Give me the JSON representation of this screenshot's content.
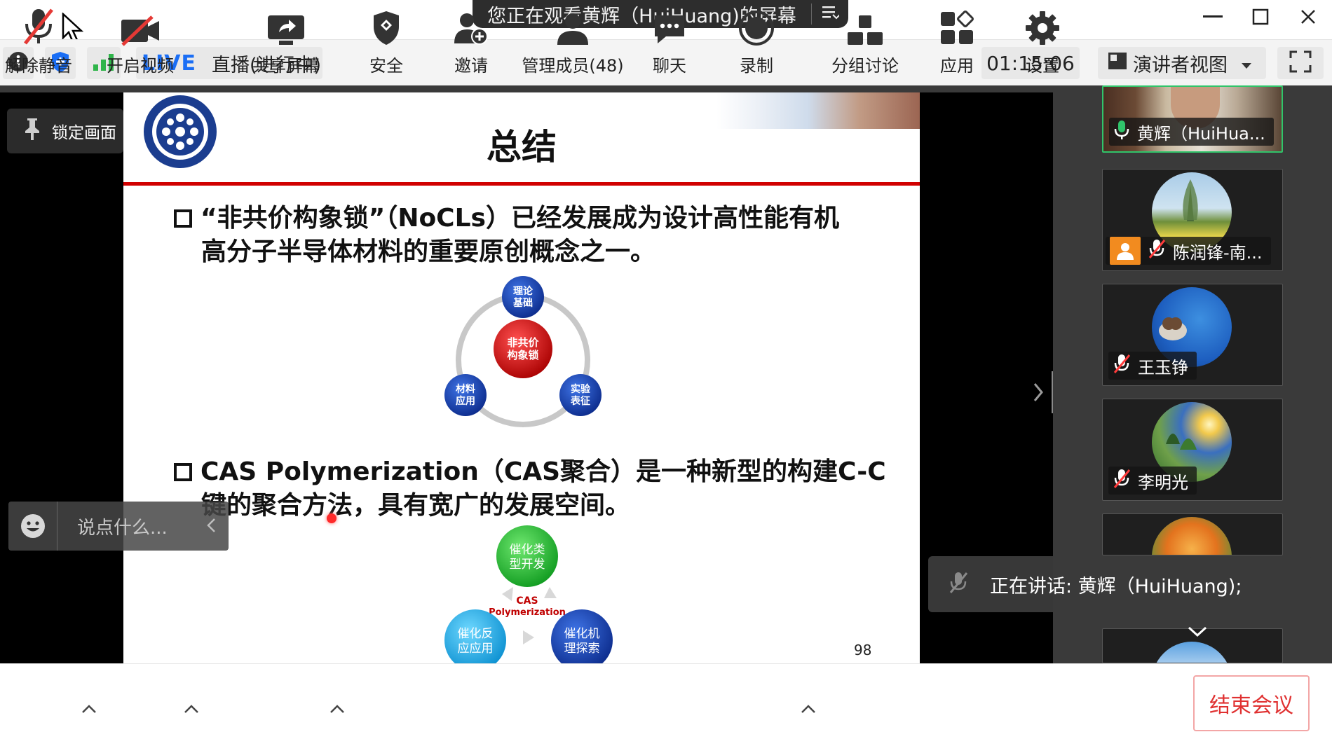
{
  "titlebar": {
    "sharing_text": "您正在观看黄辉（HuiHuang)的屏幕",
    "menu_glyph": "☰"
  },
  "statusbar": {
    "live_tag": "LIVE",
    "live_status": "直播(进行中)",
    "timer": "01:15:06",
    "view_mode": "演讲者视图"
  },
  "slide": {
    "title": "总结",
    "bullet1_line1": "“非共价构象锁”（NoCLs）已经发展成为设计高性能有机",
    "bullet1_line2": "高分子半导体材料的重要原创概念之一。",
    "bullet2_line1": "CAS Polymerization（CAS聚合）是一种新型的构建C-C",
    "bullet2_line2": "键的聚合方法，具有宽广的发展空间。",
    "diagram1": {
      "center_l1": "非共价",
      "center_l2": "构象锁",
      "top_l1": "理论",
      "top_l2": "基础",
      "left_l1": "材料",
      "left_l2": "应用",
      "right_l1": "实验",
      "right_l2": "表征"
    },
    "diagram2": {
      "top_l1": "催化类",
      "top_l2": "型开发",
      "left_l1": "催化反",
      "left_l2": "应应用",
      "right_l1": "催化机",
      "right_l2": "理探索",
      "center_l1": "CAS",
      "center_l2": "Polymerization"
    },
    "page_number": "98"
  },
  "overlay": {
    "lock_label": "锁定画面",
    "chat_placeholder": "说点什么..."
  },
  "participants": [
    {
      "name": "黄辉（HuiHua...",
      "muted": false,
      "active": true
    },
    {
      "name": "陈润锋-南...",
      "muted": true
    },
    {
      "name": "王玉铮",
      "muted": true
    },
    {
      "name": "李明光",
      "muted": true
    }
  ],
  "speaking": {
    "text": "正在讲话: 黄辉（HuiHuang);"
  },
  "toolbar": {
    "mute_label": "解除静音",
    "video_label": "开启视频",
    "share_label": "共享屏幕",
    "security_label": "安全",
    "invite_label": "邀请",
    "members_label": "管理成员(48)",
    "chat_label": "聊天",
    "record_label": "录制",
    "breakout_label": "分组讨论",
    "apps_label": "应用",
    "settings_label": "设置",
    "end_label": "结束会议"
  },
  "colors": {
    "live_blue": "#1a6ef5",
    "end_red": "#e03131",
    "active_green": "#30c46a",
    "slide_red_line": "#d10000"
  }
}
